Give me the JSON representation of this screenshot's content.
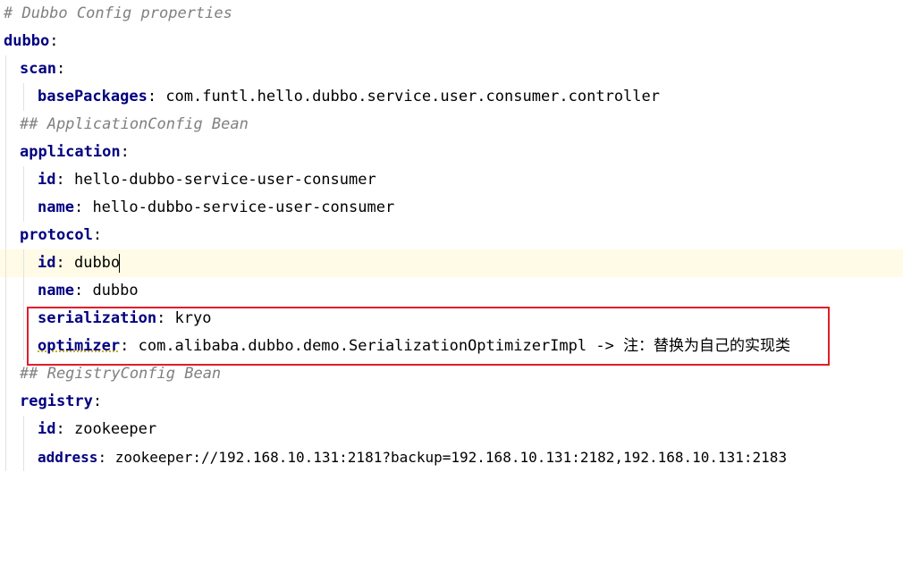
{
  "editor": {
    "line_1": {
      "comment": "# Dubbo Config properties"
    },
    "line_2": {
      "key": "dubbo",
      "colon": ":"
    },
    "line_3": {
      "key": "scan",
      "colon": ":"
    },
    "line_4": {
      "key": "basePackages",
      "colon": ":",
      "value": " com.funtl.hello.dubbo.service.user.consumer.controller"
    },
    "line_5": {
      "comment": "## ApplicationConfig Bean"
    },
    "line_6": {
      "key": "application",
      "colon": ":"
    },
    "line_7": {
      "key": "id",
      "colon": ":",
      "value": " hello-dubbo-service-user-consumer"
    },
    "line_8": {
      "key": "name",
      "colon": ":",
      "value": " hello-dubbo-service-user-consumer"
    },
    "line_9": {
      "key": "protocol",
      "colon": ":"
    },
    "line_10": {
      "key": "id",
      "colon": ":",
      "value": " dubbo"
    },
    "line_11": {
      "key": "name",
      "colon": ":",
      "value": " dubbo"
    },
    "line_12": {
      "key": "serialization",
      "colon": ":",
      "value": " kryo"
    },
    "line_13": {
      "key": "optimizer",
      "colon": ":",
      "value": " com.alibaba.dubbo.demo.SerializationOptimizerImpl -> ",
      "note": "注：替换为自己的实现类"
    },
    "line_14": {
      "comment": "## RegistryConfig Bean"
    },
    "line_15": {
      "key": "registry",
      "colon": ":"
    },
    "line_16": {
      "key": "id",
      "colon": ":",
      "value": " zookeeper"
    },
    "line_17": {
      "key": "address",
      "colon": ":",
      "value": " zookeeper://192.168.10.131:2181?backup=192.168.10.131:2182,192.168.10.131:2183"
    }
  },
  "colors": {
    "key": "#000080",
    "comment": "#808080",
    "current_line": "#fffbe6",
    "highlight_border": "#e11d2a"
  }
}
